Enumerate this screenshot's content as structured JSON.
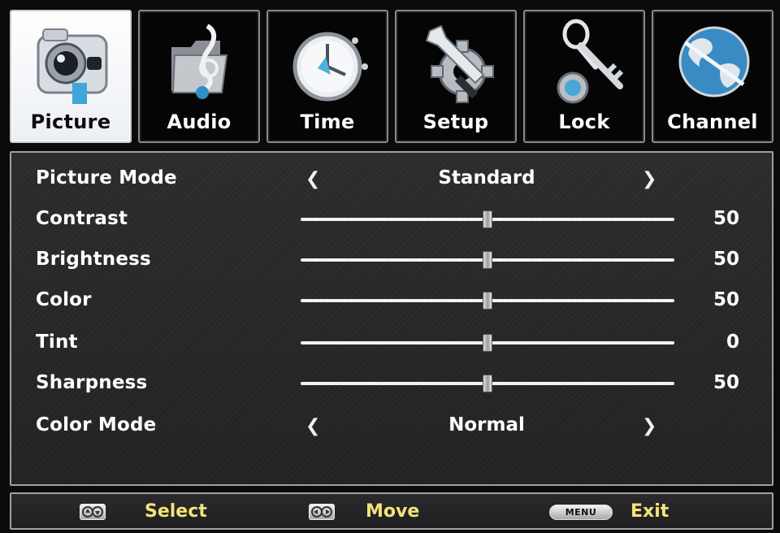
{
  "tabs": [
    {
      "label": "Picture",
      "icon": "camera-icon",
      "active": true
    },
    {
      "label": "Audio",
      "icon": "music-folder-icon",
      "active": false
    },
    {
      "label": "Time",
      "icon": "clock-icon",
      "active": false
    },
    {
      "label": "Setup",
      "icon": "wrench-gear-icon",
      "active": false
    },
    {
      "label": "Lock",
      "icon": "key-icon",
      "active": false
    },
    {
      "label": "Channel",
      "icon": "globe-icon",
      "active": false
    }
  ],
  "settings": {
    "picture_mode": {
      "label": "Picture Mode",
      "value": "Standard",
      "left_arrow": "❮",
      "right_arrow": "❯"
    },
    "contrast": {
      "label": "Contrast",
      "value": "50",
      "level": 0.5
    },
    "brightness": {
      "label": "Brightness",
      "value": "50",
      "level": 0.5
    },
    "color": {
      "label": "Color",
      "value": "50",
      "level": 0.5
    },
    "tint": {
      "label": "Tint",
      "value": "0",
      "level": 0.5
    },
    "sharpness": {
      "label": "Sharpness",
      "value": "50",
      "level": 0.5
    },
    "color_mode": {
      "label": "Color Mode",
      "value": "Normal",
      "left_arrow": "❮",
      "right_arrow": "❯"
    }
  },
  "footer": {
    "select_label": "Select",
    "select_icon": "up-down-arrows-icon",
    "move_label": "Move",
    "move_icon": "left-right-arrows-icon",
    "menu_key": "MENU",
    "exit_label": "Exit"
  },
  "colors": {
    "footer_label": "#f3e27a",
    "panel_bg": "#2b2b2d",
    "active_tab_bg": "#ffffff"
  }
}
